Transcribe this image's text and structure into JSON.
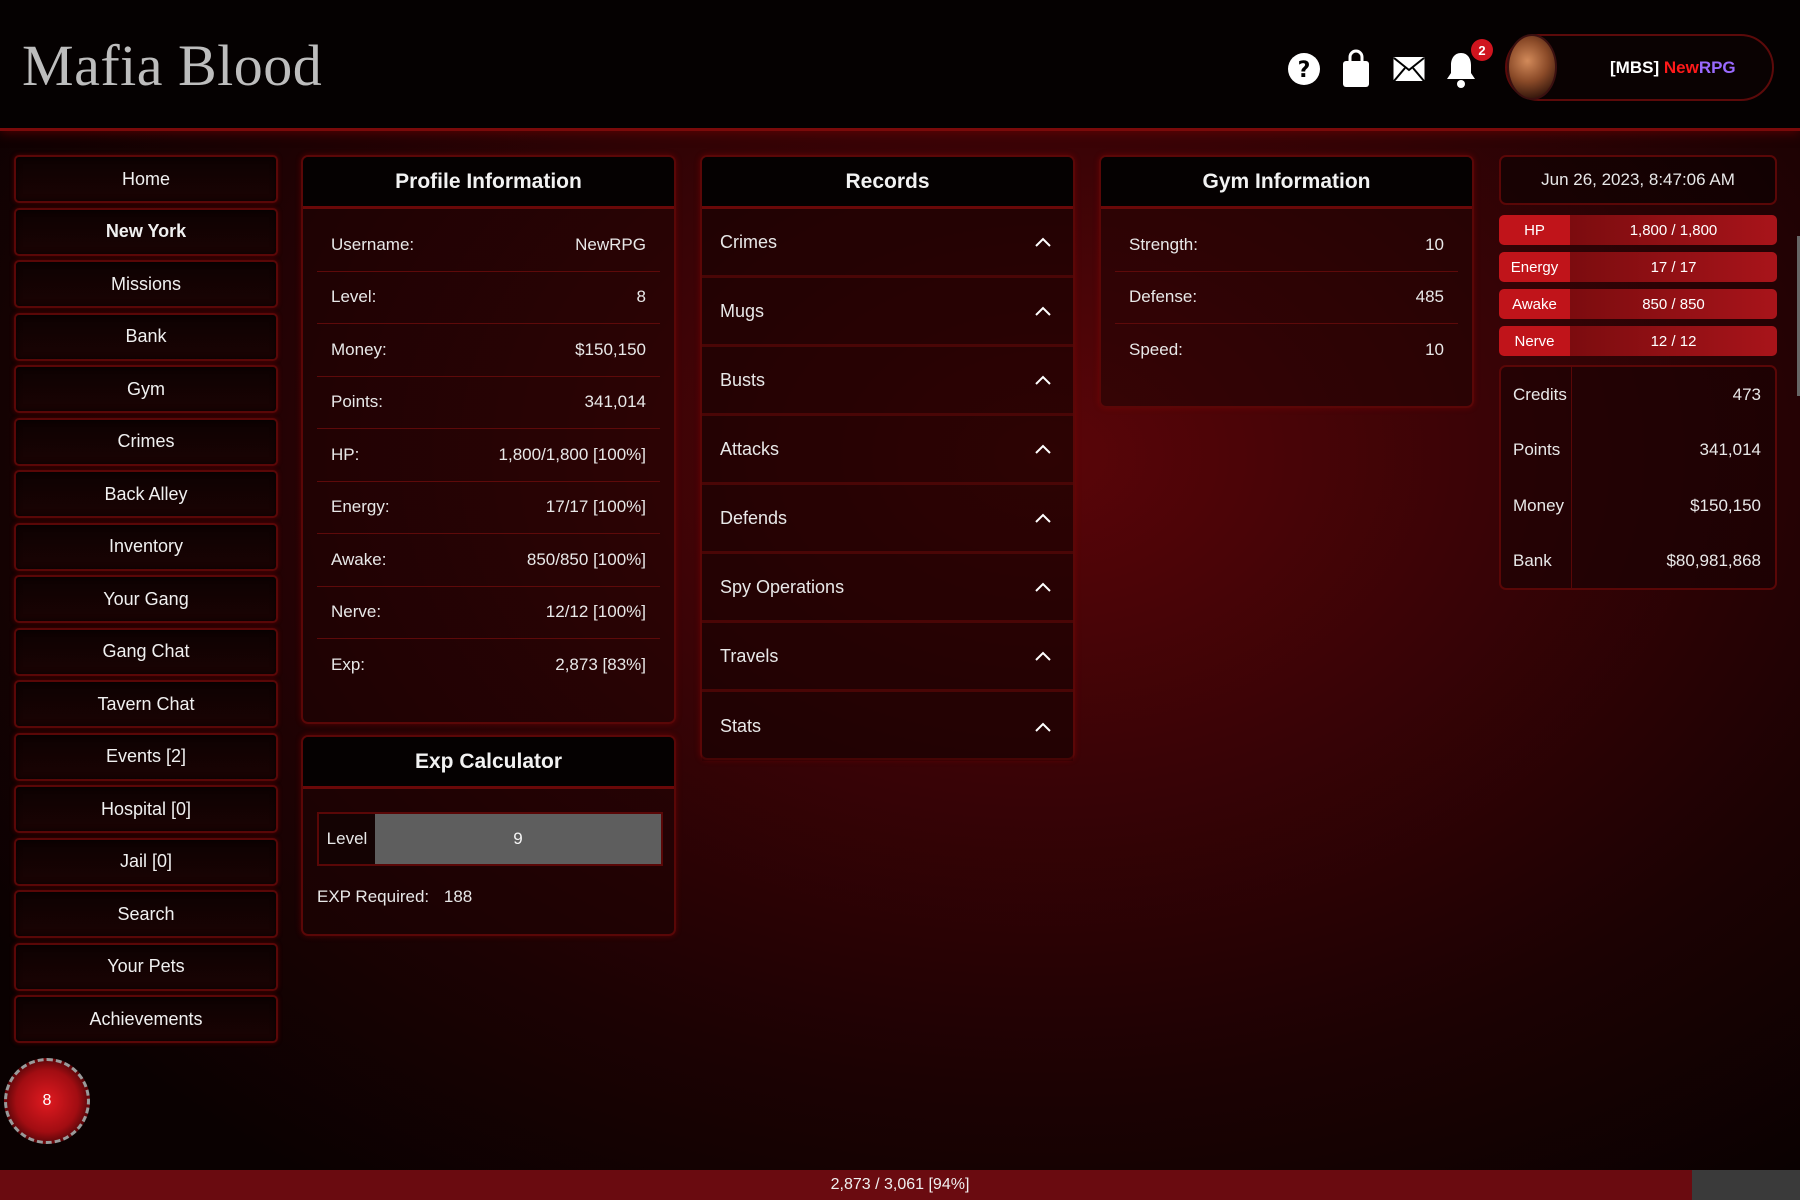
{
  "header": {
    "brand": "Mafia Blood",
    "notifications_count": "2",
    "user_tag": "[MBS]",
    "user_name_part1": "New",
    "user_name_part2": "RPG",
    "icons": [
      "help-icon",
      "shop-bag-icon",
      "mail-icon",
      "bell-icon"
    ]
  },
  "nav": {
    "items": [
      {
        "label": "Home"
      },
      {
        "label": "New York"
      },
      {
        "label": "Missions"
      },
      {
        "label": "Bank"
      },
      {
        "label": "Gym"
      },
      {
        "label": "Crimes"
      },
      {
        "label": "Back Alley"
      },
      {
        "label": "Inventory"
      },
      {
        "label": "Your Gang"
      },
      {
        "label": "Gang Chat"
      },
      {
        "label": "Tavern Chat"
      },
      {
        "label": "Events [2]"
      },
      {
        "label": "Hospital [0]"
      },
      {
        "label": "Jail [0]"
      },
      {
        "label": "Search"
      },
      {
        "label": "Your Pets"
      },
      {
        "label": "Achievements"
      }
    ]
  },
  "profile": {
    "title": "Profile Information",
    "rows": [
      {
        "label": "Username:",
        "value": "NewRPG"
      },
      {
        "label": "Level:",
        "value": "8"
      },
      {
        "label": "Money:",
        "value": "$150,150"
      },
      {
        "label": "Points:",
        "value": "341,014"
      },
      {
        "label": "HP:",
        "value": "1,800/1,800 [100%]"
      },
      {
        "label": "Energy:",
        "value": "17/17 [100%]"
      },
      {
        "label": "Awake:",
        "value": "850/850 [100%]"
      },
      {
        "label": "Nerve:",
        "value": "12/12 [100%]"
      },
      {
        "label": "Exp:",
        "value": "2,873 [83%]"
      }
    ]
  },
  "exp_calc": {
    "title": "Exp Calculator",
    "level_label": "Level",
    "level_value": "9",
    "required_label": "EXP Required:",
    "required_value": "188"
  },
  "records": {
    "title": "Records",
    "items": [
      {
        "label": "Crimes"
      },
      {
        "label": "Mugs"
      },
      {
        "label": "Busts"
      },
      {
        "label": "Attacks"
      },
      {
        "label": "Defends"
      },
      {
        "label": "Spy Operations"
      },
      {
        "label": "Travels"
      },
      {
        "label": "Stats"
      }
    ]
  },
  "gym": {
    "title": "Gym Information",
    "rows": [
      {
        "label": "Strength:",
        "value": "10"
      },
      {
        "label": "Defense:",
        "value": "485"
      },
      {
        "label": "Speed:",
        "value": "10"
      }
    ]
  },
  "status": {
    "datetime": "Jun 26, 2023, 8:47:06 AM",
    "bars": [
      {
        "label": "HP",
        "text": "1,800 / 1,800",
        "fraction": 1.0
      },
      {
        "label": "Energy",
        "text": "17 / 17",
        "fraction": 1.0
      },
      {
        "label": "Awake",
        "text": "850 / 850",
        "fraction": 1.0
      },
      {
        "label": "Nerve",
        "text": "12 / 12",
        "fraction": 1.0
      }
    ],
    "stats": [
      {
        "label": "Credits",
        "value": "473"
      },
      {
        "label": "Points",
        "value": "341,014"
      },
      {
        "label": "Money",
        "value": "$150,150"
      },
      {
        "label": "Bank",
        "value": "$80,981,868"
      }
    ]
  },
  "level_orb": "8",
  "exp_bar": {
    "text": "2,873 / 3,061 [94%]",
    "fraction": 0.94
  },
  "colors": {
    "accent": "#c0141a",
    "border": "#5a0707",
    "header": "#050101"
  }
}
